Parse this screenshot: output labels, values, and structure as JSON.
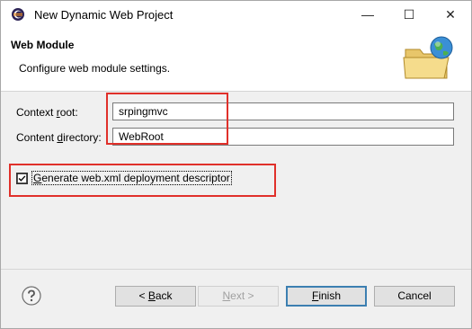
{
  "window": {
    "title": "New Dynamic Web Project",
    "minimize_glyph": "—",
    "maximize_glyph": "☐",
    "close_glyph": "✕"
  },
  "header": {
    "title": "Web Module",
    "description": "Configure web module settings.",
    "image": "folder-globe-icon"
  },
  "form": {
    "context_root": {
      "label_pre": "Context ",
      "label_mnemonic": "r",
      "label_post": "oot:",
      "value": "srpingmvc"
    },
    "content_directory": {
      "label_pre": "Content ",
      "label_mnemonic": "d",
      "label_post": "irectory:",
      "value": "WebRoot"
    },
    "generate_descriptor": {
      "label_pre": "",
      "label_mnemonic": "G",
      "label_post": "enerate web.xml deployment descriptor",
      "checked": true
    }
  },
  "buttons": {
    "back": {
      "label_pre": "< ",
      "label_mnemonic": "B",
      "label_post": "ack"
    },
    "next": {
      "label_pre": "",
      "label_mnemonic": "N",
      "label_post": "ext >"
    },
    "finish": {
      "label_pre": "",
      "label_mnemonic": "F",
      "label_post": "inish"
    },
    "cancel": {
      "label": "Cancel"
    }
  },
  "colors": {
    "annotation": "#e0302a",
    "default_button_border": "#3c7fb1"
  }
}
